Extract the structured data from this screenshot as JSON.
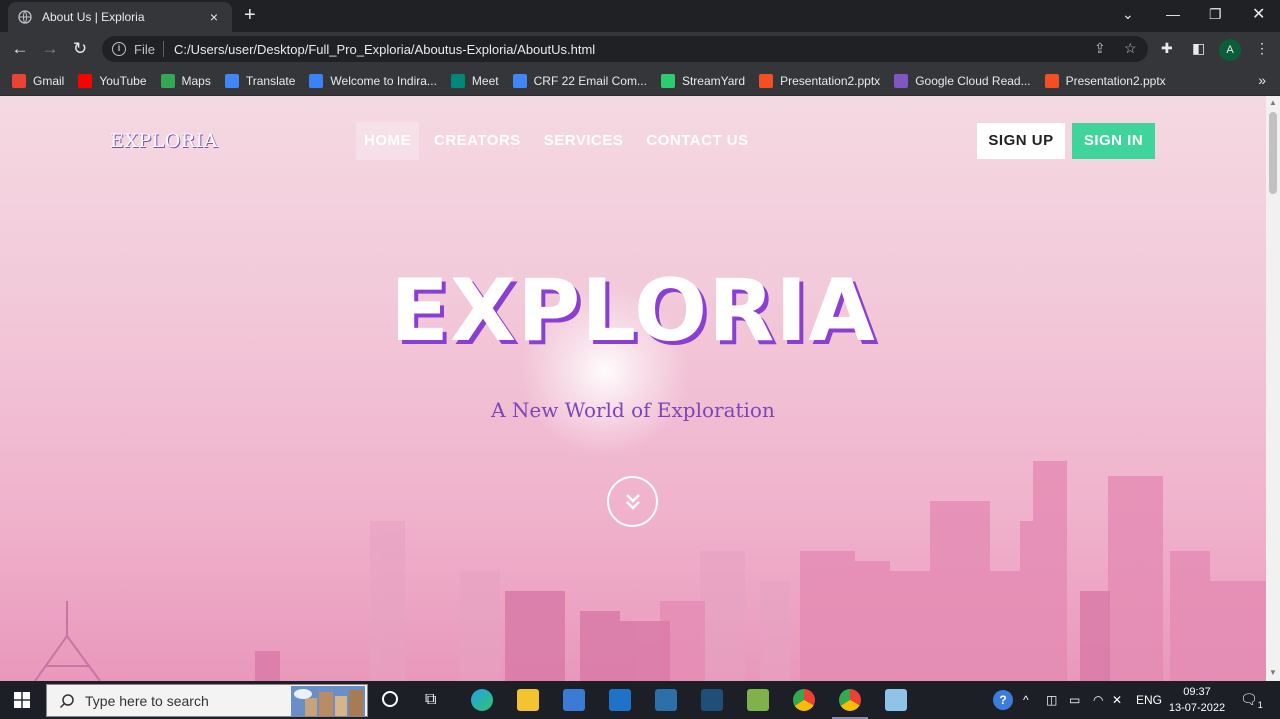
{
  "browser": {
    "tab_title": "About Us | Exploria",
    "tab_close": "×",
    "new_tab": "+",
    "scheme_label": "File",
    "url": "C:/Users/user/Desktop/Full_Pro_Exploria/Aboutus-Exploria/AboutUs.html",
    "profile_initial": "A",
    "bookmarks": [
      {
        "label": "Gmail",
        "icon": "gmail-icon",
        "color": "#ea4335"
      },
      {
        "label": "YouTube",
        "icon": "youtube-icon",
        "color": "#ff0000"
      },
      {
        "label": "Maps",
        "icon": "maps-icon",
        "color": "#34a853"
      },
      {
        "label": "Translate",
        "icon": "translate-icon",
        "color": "#4285f4"
      },
      {
        "label": "Welcome to Indira...",
        "icon": "site-icon",
        "color": "#3b82f6"
      },
      {
        "label": "Meet",
        "icon": "meet-icon",
        "color": "#00897b"
      },
      {
        "label": "CRF 22 Email Com...",
        "icon": "forms-icon",
        "color": "#4285f4"
      },
      {
        "label": "StreamYard",
        "icon": "streamyard-icon",
        "color": "#2ecc71"
      },
      {
        "label": "Presentation2.pptx",
        "icon": "microsoft-icon",
        "color": "#f25022"
      },
      {
        "label": "Google Cloud Read...",
        "icon": "cloud-icon",
        "color": "#7e57c2"
      },
      {
        "label": "Presentation2.pptx",
        "icon": "microsoft-icon",
        "color": "#f25022"
      }
    ],
    "more_bookmarks": "»"
  },
  "site": {
    "logo": "EXPLORIA",
    "nav": [
      "HOME",
      "CREATORS",
      "SERVICES",
      "CONTACT US"
    ],
    "active_nav": "HOME",
    "signup_label": "SIGN UP",
    "signin_label": "SIGN IN",
    "hero_title": "EXPLORIA",
    "hero_subtitle": "A New World of Exploration",
    "colors": {
      "signin_bg": "#3ed49b",
      "title_shadow": "#8a3fd0",
      "subtitle": "#7c46b8"
    }
  },
  "taskbar": {
    "search_placeholder": "Type here to search",
    "language": "ENG",
    "time": "09:37",
    "date": "13-07-2022",
    "notification_count": "1"
  }
}
